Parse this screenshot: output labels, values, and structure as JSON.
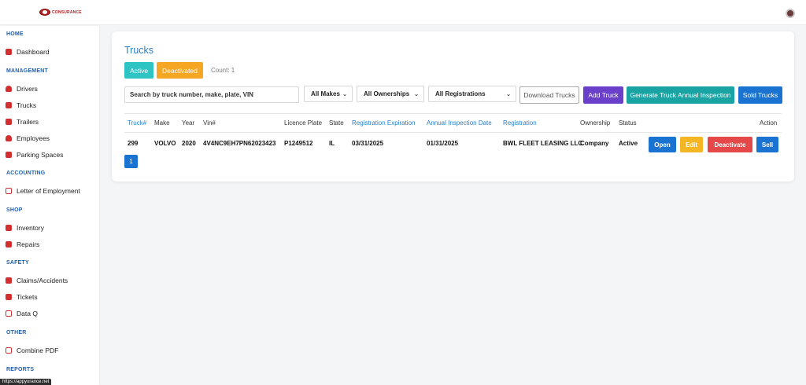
{
  "header": {
    "logo_text": "CONSURANCE",
    "avatar_icon": "user-avatar"
  },
  "sidebar": {
    "home_label": "HOME",
    "dashboard": "Dashboard",
    "management_label": "MANAGEMENT",
    "drivers": "Drivers",
    "trucks": "Trucks",
    "trailers": "Trailers",
    "employees": "Employees",
    "parking": "Parking Spaces",
    "accounting_label": "ACCOUNTING",
    "letter": "Letter of Employment",
    "shop_label": "SHOP",
    "inventory": "Inventory",
    "repairs": "Repairs",
    "safety_label": "SAFETY",
    "claims": "Claims/Accidents",
    "tickets": "Tickets",
    "dataq": "Data Q",
    "other_label": "OTHER",
    "combine": "Combine PDF",
    "reports_label": "REPORTS"
  },
  "status_url": "https://appyurance.net",
  "page": {
    "title": "Trucks",
    "active_label": "Active",
    "deactivated_label": "Deactivated",
    "count_text": "Count: 1"
  },
  "toolbar": {
    "search_placeholder": "Search by truck number, make, plate, VIN",
    "makes": "All Makes",
    "ownerships": "All Ownerships",
    "registrations": "All Registrations",
    "download": "Download Trucks",
    "add": "Add Truck",
    "inspection": "Generate Truck Annual Inspection",
    "sold": "Sold Trucks"
  },
  "table": {
    "headers": {
      "truck": "Truck#",
      "make": "Make",
      "year": "Year",
      "vin": "Vin#",
      "plate": "Licence Plate",
      "state": "State",
      "reg_exp": "Registration Expiration",
      "annual": "Annual Inspection Date",
      "registration": "Registration",
      "ownership": "Ownership",
      "status": "Status",
      "action": "Action"
    },
    "rows": [
      {
        "truck": "299",
        "make": "VOLVO",
        "year": "2020",
        "vin": "4V4NC9EH7PN62023423",
        "plate": "P1249512",
        "state": "IL",
        "reg_exp": "03/31/2025",
        "annual": "01/31/2025",
        "registration": "BWL FLEET LEASING LLC",
        "ownership": "Company",
        "status": "Active",
        "open": "Open",
        "edit": "Edit",
        "deactivate": "Deactivate",
        "sell": "Sell"
      }
    ]
  },
  "pagination": {
    "current": "1"
  },
  "colors": {
    "accent_blue": "#2a7fc9",
    "active_teal": "#2ec4c4",
    "deactivated_orange": "#f5a623",
    "add_purple": "#6a3fc9",
    "danger_red": "#e54848"
  }
}
